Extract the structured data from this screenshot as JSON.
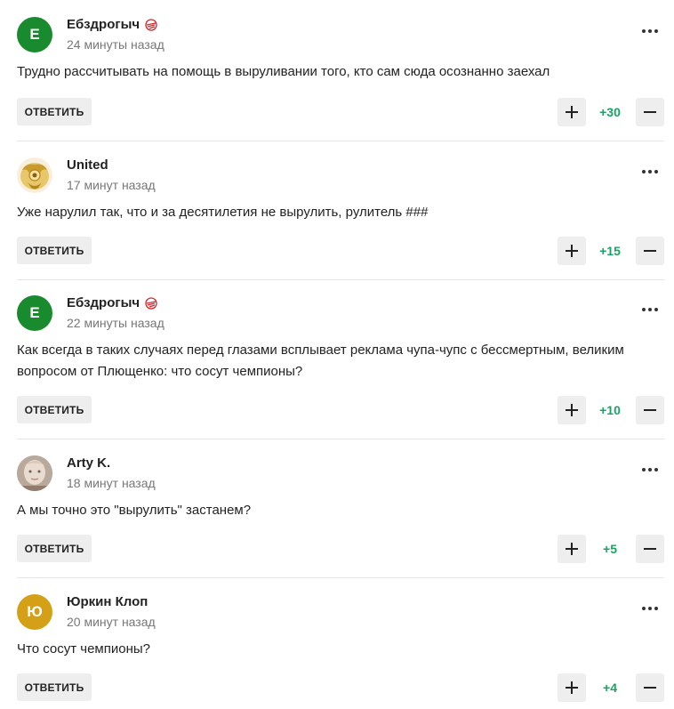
{
  "colors": {
    "accent_green": "#19a463",
    "button_bg": "#eeeeee",
    "text": "#222222",
    "muted": "#777777"
  },
  "comments": [
    {
      "author": "Ебздрогыч",
      "avatar_letter": "Е",
      "avatar_color": "#1a8a2e",
      "badge_icon": "spartak-badge-icon",
      "time": "24 минуты назад",
      "text": "Трудно рассчитывать на помощь в выруливании того, кто сам сюда осознанно заехал",
      "reply_label": "ОТВЕТИТЬ",
      "score": "+30"
    },
    {
      "author": "United",
      "avatar_letter": "",
      "avatar_color": "#f3e6c2",
      "avatar_icon": "golden-emblem-icon",
      "time": "17 минут назад",
      "text": "Уже нарулил так, что и за десятилетия не вырулить, рулитель ###",
      "reply_label": "ОТВЕТИТЬ",
      "score": "+15"
    },
    {
      "author": "Ебздрогыч",
      "avatar_letter": "Е",
      "avatar_color": "#1a8a2e",
      "badge_icon": "spartak-badge-icon",
      "time": "22 минуты назад",
      "text": "Как всегда в таких случаях перед глазами всплывает реклама чупа-чупс с бессмертным, великим вопросом от Плющенко: что сосут чемпионы?",
      "reply_label": "ОТВЕТИТЬ",
      "score": "+10"
    },
    {
      "author": "Arty K.",
      "avatar_letter": "",
      "avatar_color": "#c9b9ad",
      "avatar_icon": "photo-avatar-icon",
      "time": "18 минут назад",
      "text": "А мы точно это \"вырулить\" застанем?",
      "reply_label": "ОТВЕТИТЬ",
      "score": "+5"
    },
    {
      "author": "Юркин Клоп",
      "avatar_letter": "Ю",
      "avatar_color": "#d4a017",
      "time": "20 минут назад",
      "text": "Что сосут чемпионы?",
      "reply_label": "ОТВЕТИТЬ",
      "score": "+4"
    }
  ]
}
